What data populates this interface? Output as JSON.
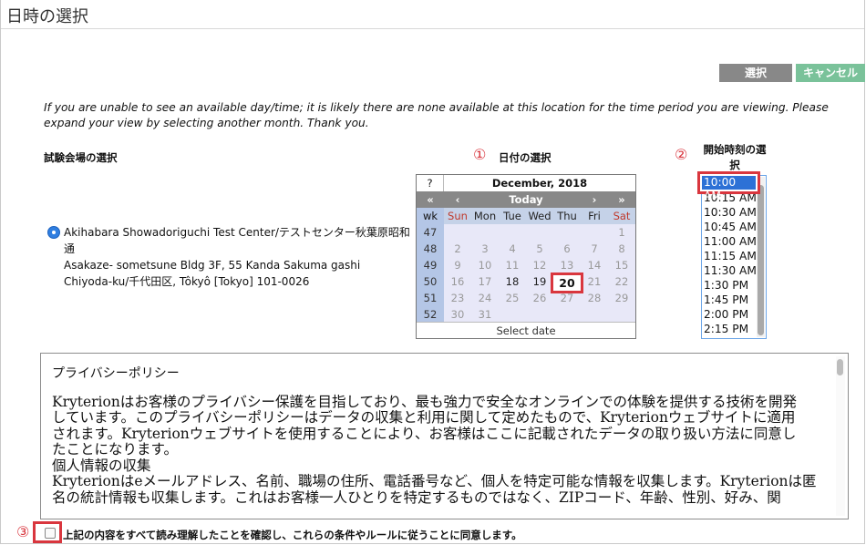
{
  "title": "日時の選択",
  "buttons": {
    "select": "選択",
    "cancel": "キャンセル"
  },
  "notice": "If you are unable to see an available day/time; it is likely there are none available at this location for the time period you are viewing. Please expand your view by selecting another month. Thank you.",
  "site": {
    "label": "試験会場の選択",
    "lines": [
      "Akihabara Showadoriguchi Test Center/テストセンター秋葉原昭和",
      "通",
      "Asakaze- sometsune Bldg 3F, 55 Kanda Sakuma gashi",
      "Chiyoda-ku/千代田区, Tôkyô [Tokyo] 101-0026"
    ]
  },
  "steps": {
    "one": "①",
    "two": "②",
    "three": "③"
  },
  "date_label": "日付の選択",
  "time_label": "開始時刻の選択",
  "calendar": {
    "help": "?",
    "month": "December, 2018",
    "nav": {
      "prev_year": "«",
      "prev": "‹",
      "today": "Today",
      "next": "›",
      "next_year": "»"
    },
    "headers": [
      "wk",
      "Sun",
      "Mon",
      "Tue",
      "Wed",
      "Thu",
      "Fri",
      "Sat"
    ],
    "weeks": [
      {
        "wk": "47",
        "days": [
          "",
          "",
          "",
          "",
          "",
          "",
          "1"
        ]
      },
      {
        "wk": "48",
        "days": [
          "2",
          "3",
          "4",
          "5",
          "6",
          "7",
          "8"
        ]
      },
      {
        "wk": "49",
        "days": [
          "9",
          "10",
          "11",
          "12",
          "13",
          "14",
          "15"
        ]
      },
      {
        "wk": "50",
        "days": [
          "16",
          "17",
          "18",
          "19",
          "20",
          "21",
          "22"
        ]
      },
      {
        "wk": "51",
        "days": [
          "23",
          "24",
          "25",
          "26",
          "27",
          "28",
          "29"
        ]
      },
      {
        "wk": "52",
        "days": [
          "30",
          "31",
          "",
          "",
          "",
          "",
          ""
        ]
      }
    ],
    "available": [
      "18",
      "19"
    ],
    "selected": "20",
    "footer": "Select date"
  },
  "times": {
    "selected": "10:00 AM",
    "items": [
      "10:15 AM",
      "10:30 AM",
      "10:45 AM",
      "11:00 AM",
      "11:15 AM",
      "11:30 AM",
      "1:30 PM",
      "1:45 PM",
      "2:00 PM",
      "2:15 PM"
    ]
  },
  "policy": {
    "title": "プライバシーポリシー",
    "lines": [
      "Kryterionはお客様のプライバシー保護を目指しており、最も強力で安全なオンラインでの体験を提供する技術を開発",
      "しています。このプライバシーポリシーはデータの収集と利用に関して定めたもので、Kryterionウェブサイトに適用",
      "されます。Kryterionウェブサイトを使用することにより、お客様はここに記載されたデータの取り扱い方法に同意し",
      "たことになります。",
      "個人情報の収集",
      "Kryterionはeメールアドレス、名前、職場の住所、電話番号など、個人を特定可能な情報を収集します。Kryterionは匿",
      "名の統計情報も収集します。これはお客様一人ひとりを特定するものではなく、ZIPコード、年齢、性別、好み、関"
    ]
  },
  "agree": "上記の内容をすべて読み理解したことを確認し、これらの条件やルールに従うことに同意します。"
}
